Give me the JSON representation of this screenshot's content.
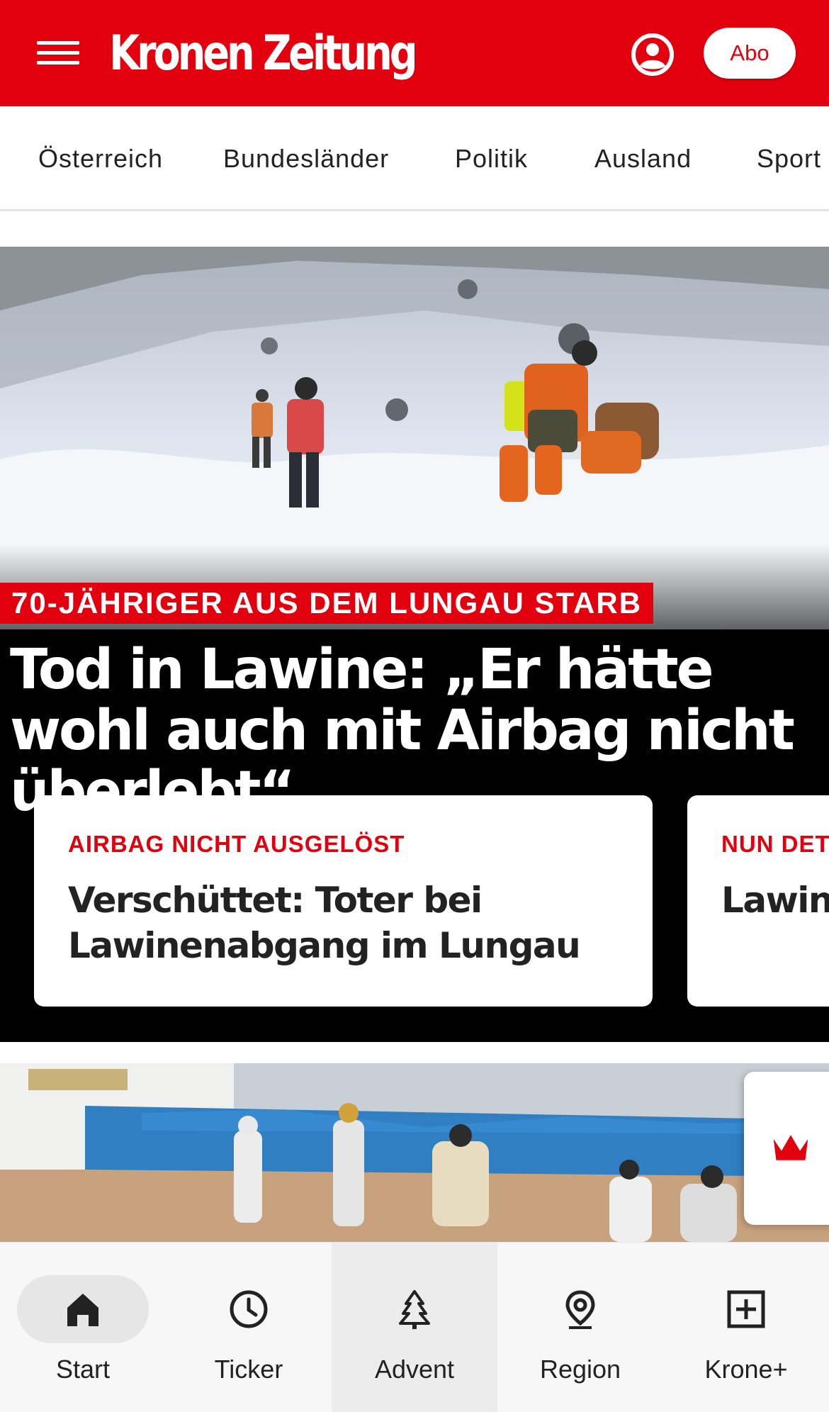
{
  "header": {
    "brand": "Kronen Zeitung",
    "abo_label": "Abo",
    "brand_color": "#e2000f"
  },
  "categories": [
    "Österreich",
    "Bundesländer",
    "Politik",
    "Ausland",
    "Sport"
  ],
  "hero": {
    "kicker": "70-JÄHRIGER AUS DEM LUNGAU STARB",
    "title": "Tod in Lawine: „Er hätte wohl auch mit Airbag nicht überlebt“",
    "cards": [
      {
        "kicker": "AIRBAG NICHT AUSGELÖST",
        "title": "Verschüttet: Toter bei Lawinenabgang im Lungau"
      },
      {
        "kicker": "NUN DET",
        "title": "Lawine waren"
      }
    ]
  },
  "bottom_nav": {
    "items": [
      {
        "label": "Start",
        "icon": "home-icon"
      },
      {
        "label": "Ticker",
        "icon": "clock-icon"
      },
      {
        "label": "Advent",
        "icon": "tree-icon"
      },
      {
        "label": "Region",
        "icon": "location-pin-icon"
      },
      {
        "label": "Krone+",
        "icon": "plus-box-icon"
      }
    ]
  }
}
